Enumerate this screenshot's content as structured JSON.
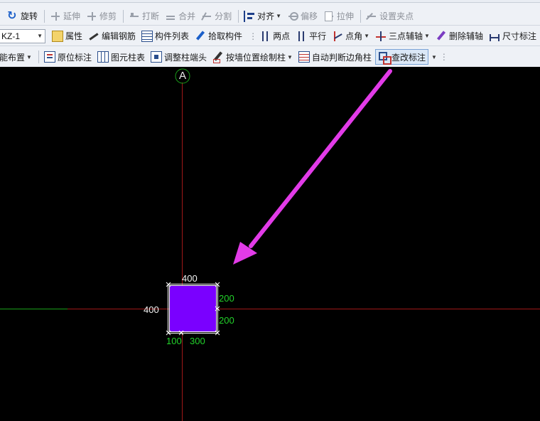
{
  "toolbar": {
    "row1": {
      "rotate": "旋转",
      "extend": "延伸",
      "trim": "修剪",
      "break": "打断",
      "merge": "合并",
      "split": "分割",
      "align": "对齐",
      "offset": "偏移",
      "stretch": "拉伸",
      "set_grip": "设置夹点"
    },
    "row2": {
      "component_select": "KZ-1",
      "properties": "属性",
      "edit_rebar": "编辑钢筋",
      "component_list": "构件列表",
      "pick_component": "拾取构件",
      "two_points": "两点",
      "parallel": "平行",
      "point_angle": "点角",
      "three_point_axis": "三点辅轴",
      "delete_axis": "删除辅轴",
      "dimension": "尺寸标注"
    },
    "row3": {
      "smart_layout": "能布置",
      "in_place_annotation": "原位标注",
      "element_column_table": "图元柱表",
      "adjust_column_end": "调整柱端头",
      "draw_by_wall": "按墙位置绘制柱",
      "auto_corner_column": "自动判断边角柱",
      "check_annotation": "查改标注"
    }
  },
  "canvas": {
    "axis_bubble": "A",
    "dims": {
      "top": "400",
      "left": "400",
      "right_upper": "200",
      "right_lower": "200",
      "bottom_left": "100",
      "bottom_right": "300"
    },
    "colors": {
      "background": "#000000",
      "column_fill": "#7a00ff",
      "axis_red": "#a01818",
      "axis_green": "#1aa01a",
      "arrow": "#e23be8",
      "dim_green": "#22d22a",
      "dim_white": "#f2f2f2"
    }
  }
}
